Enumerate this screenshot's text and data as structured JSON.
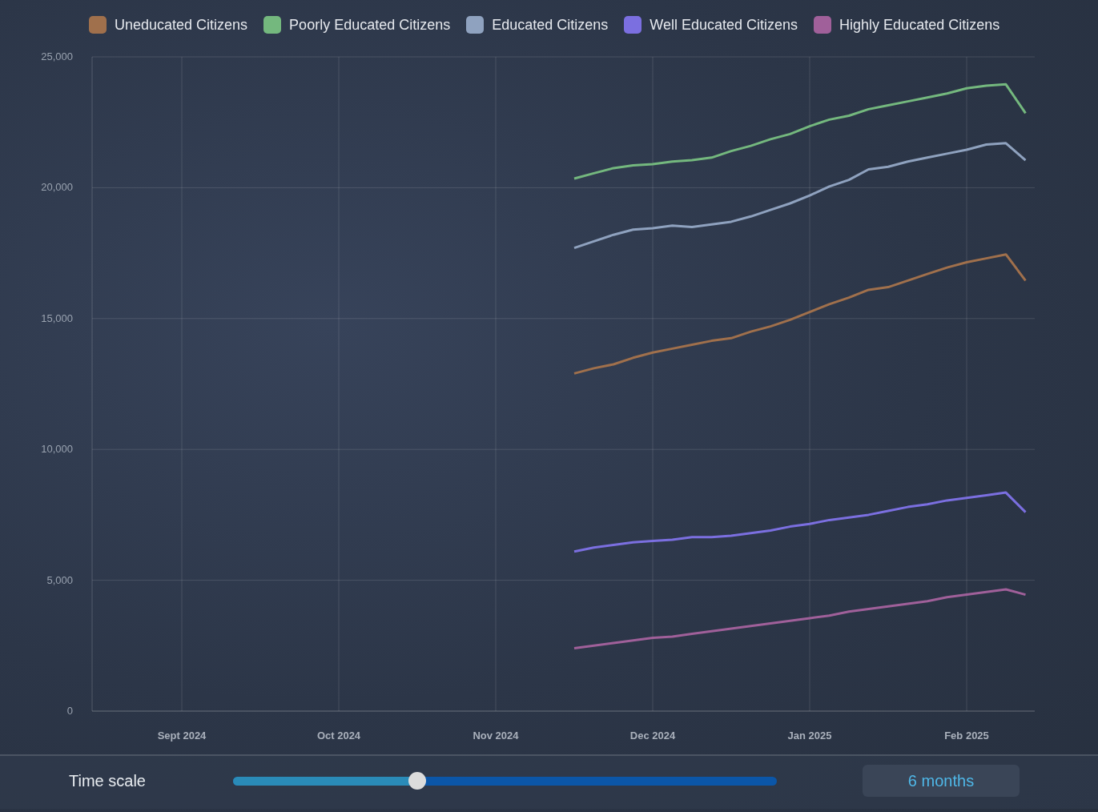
{
  "chart": {
    "chart_data": {
      "type": "line",
      "categories": [
        null,
        null,
        null,
        null,
        "Sept 2024",
        null,
        null,
        null,
        null,
        null,
        null,
        null,
        "Oct 2024",
        null,
        null,
        null,
        null,
        null,
        null,
        null,
        "Nov 2024",
        null,
        null,
        null,
        null,
        null,
        null,
        null,
        "Dec 2024",
        null,
        null,
        null,
        null,
        null,
        null,
        null,
        "Jan 2025",
        null,
        null,
        null,
        null,
        null,
        null,
        null,
        "Feb 2025",
        null,
        null,
        null
      ],
      "series": [
        {
          "name": "Uneducated Citizens",
          "color": "#a0704c",
          "values": [
            null,
            null,
            null,
            null,
            null,
            null,
            null,
            null,
            null,
            null,
            null,
            null,
            null,
            null,
            null,
            null,
            null,
            null,
            null,
            null,
            null,
            null,
            null,
            null,
            12900,
            13100,
            13250,
            13500,
            13700,
            13850,
            14000,
            14150,
            14250,
            14500,
            14700,
            14950,
            15250,
            15550,
            15800,
            16100,
            16200,
            16450,
            16700,
            16950,
            17150,
            17300,
            17450,
            16450
          ]
        },
        {
          "name": "Poorly Educated Citizens",
          "color": "#74b87e",
          "values": [
            null,
            null,
            null,
            null,
            null,
            null,
            null,
            null,
            null,
            null,
            null,
            null,
            null,
            null,
            null,
            null,
            null,
            null,
            null,
            null,
            null,
            null,
            null,
            null,
            20350,
            20550,
            20750,
            20850,
            20900,
            21000,
            21050,
            21150,
            21400,
            21600,
            21850,
            22050,
            22350,
            22600,
            22750,
            23000,
            23150,
            23300,
            23450,
            23600,
            23800,
            23900,
            23950,
            22850
          ]
        },
        {
          "name": "Educated Citizens",
          "color": "#8fa2bf",
          "values": [
            null,
            null,
            null,
            null,
            null,
            null,
            null,
            null,
            null,
            null,
            null,
            null,
            null,
            null,
            null,
            null,
            null,
            null,
            null,
            null,
            null,
            null,
            null,
            null,
            17700,
            17950,
            18200,
            18400,
            18450,
            18550,
            18500,
            18600,
            18700,
            18900,
            19150,
            19400,
            19700,
            20050,
            20300,
            20700,
            20800,
            21000,
            21150,
            21300,
            21450,
            21650,
            21700,
            21050
          ]
        },
        {
          "name": "Well Educated Citizens",
          "color": "#7b6fe0",
          "values": [
            null,
            null,
            null,
            null,
            null,
            null,
            null,
            null,
            null,
            null,
            null,
            null,
            null,
            null,
            null,
            null,
            null,
            null,
            null,
            null,
            null,
            null,
            null,
            null,
            6100,
            6250,
            6350,
            6450,
            6500,
            6550,
            6650,
            6650,
            6700,
            6800,
            6900,
            7050,
            7150,
            7300,
            7400,
            7500,
            7650,
            7800,
            7900,
            8050,
            8150,
            8250,
            8350,
            7600
          ]
        },
        {
          "name": "Highly Educated Citizens",
          "color": "#a0609a",
          "values": [
            null,
            null,
            null,
            null,
            null,
            null,
            null,
            null,
            null,
            null,
            null,
            null,
            null,
            null,
            null,
            null,
            null,
            null,
            null,
            null,
            null,
            null,
            null,
            null,
            2400,
            2500,
            2600,
            2700,
            2800,
            2850,
            2950,
            3050,
            3150,
            3250,
            3350,
            3450,
            3550,
            3650,
            3800,
            3900,
            4000,
            4100,
            4200,
            4350,
            4450,
            4550,
            4650,
            4450
          ]
        }
      ],
      "grid": true,
      "ylim": [
        0,
        25000
      ],
      "yticks": [
        {
          "value": 0,
          "label": "0"
        },
        {
          "value": 5000,
          "label": "5,000"
        },
        {
          "value": 10000,
          "label": "10,000"
        },
        {
          "value": 15000,
          "label": "15,000"
        },
        {
          "value": 20000,
          "label": "20,000"
        },
        {
          "value": 25000,
          "label": "25,000"
        }
      ]
    }
  },
  "time_scale": {
    "label": "Time scale",
    "level": 0.339,
    "reading": "6 months"
  }
}
